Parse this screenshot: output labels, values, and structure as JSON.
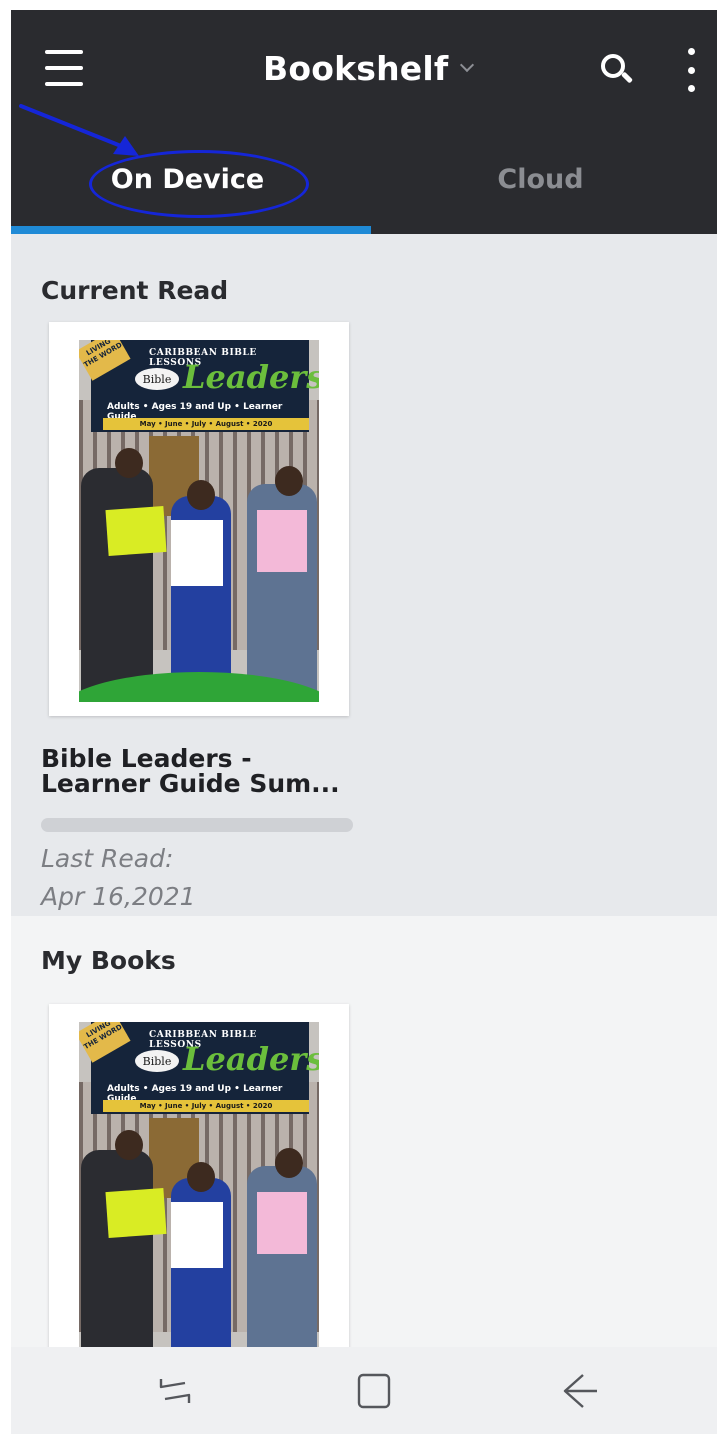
{
  "appbar": {
    "title": "Bookshelf",
    "icons": {
      "menu": "hamburger-menu-icon",
      "dropdown": "chevron-down-icon",
      "search": "search-icon",
      "more": "more-vertical-icon"
    }
  },
  "tabs": [
    {
      "label": "On Device",
      "selected": true
    },
    {
      "label": "Cloud",
      "selected": false
    }
  ],
  "colors": {
    "appbar": "#2a2b2f",
    "accent": "#1f8ad6",
    "annotation": "#1526d8"
  },
  "current_read": {
    "section_title": "Current Read",
    "book": {
      "title_line1": "Bible Leaders -",
      "title_line2": "Learner Guide Sum...",
      "progress": 0,
      "last_read_label": "Last Read:",
      "last_read_date": "Apr 16,2021",
      "cover": {
        "series": "CARIBBEAN BIBLE LESSONS",
        "corner": "LIVING THE WORD",
        "bible": "Bible",
        "leaders": "Leaders",
        "subtitle": "Adults • Ages 19 and Up • Learner Guide",
        "dates": "May • June • July • August • 2020"
      }
    }
  },
  "my_books": {
    "section_title": "My Books",
    "books": [
      {
        "cover": {
          "series": "CARIBBEAN BIBLE LESSONS",
          "corner": "LIVING THE WORD",
          "bible": "Bible",
          "leaders": "Leaders",
          "subtitle": "Adults • Ages 19 and Up • Learner Guide",
          "dates": "May • June • July • August • 2020"
        }
      }
    ]
  },
  "navbar": {
    "recent": "recent-apps-icon",
    "home": "home-icon",
    "back": "back-arrow-icon"
  }
}
